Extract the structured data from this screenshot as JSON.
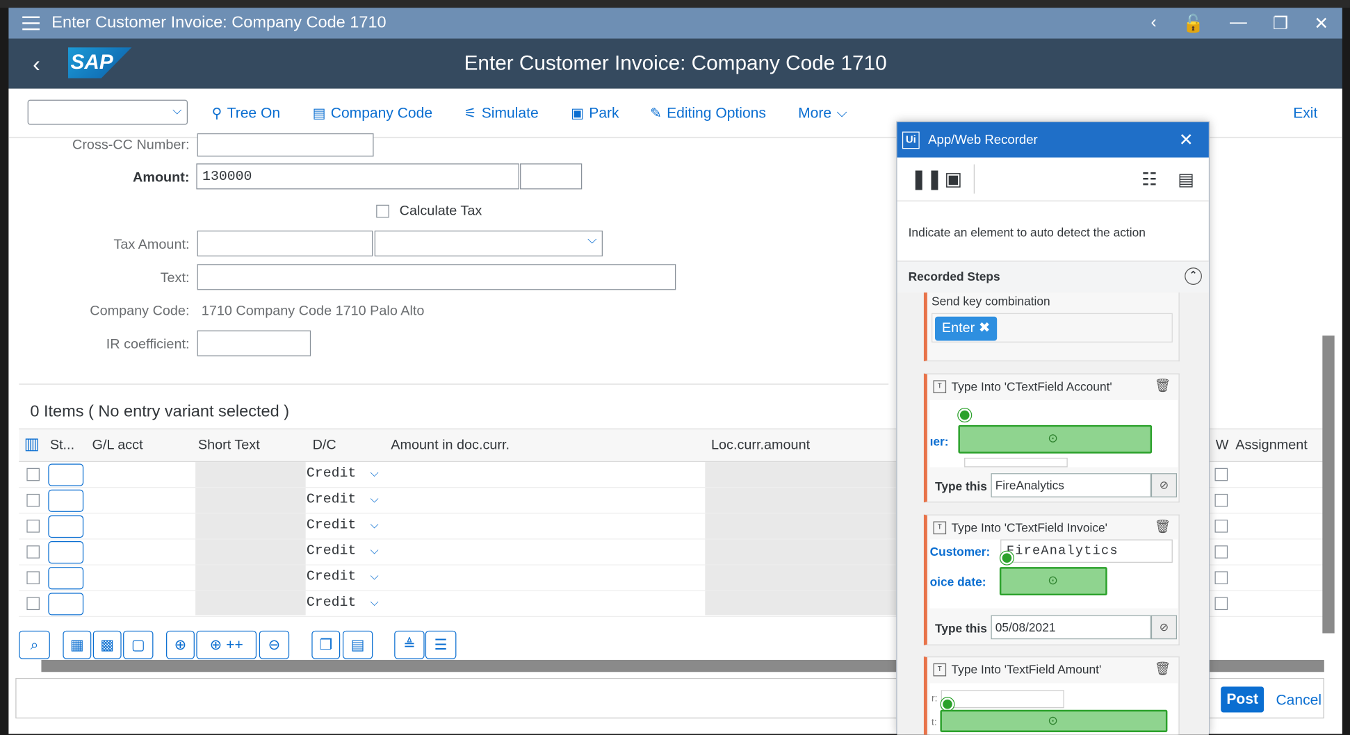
{
  "window": {
    "title": "Enter Customer Invoice: Company Code 1710"
  },
  "shell": {
    "title": "Enter Customer Invoice: Company Code 1710",
    "logo": "SAP"
  },
  "toolbar": {
    "items": [
      {
        "label": "Tree On",
        "icon": "tree-icon"
      },
      {
        "label": "Company Code",
        "icon": "company-code-icon"
      },
      {
        "label": "Simulate",
        "icon": "simulate-icon"
      },
      {
        "label": "Park",
        "icon": "save-icon"
      },
      {
        "label": "Editing Options",
        "icon": "pencil-icon"
      },
      {
        "label": "More",
        "icon": "chevron-down-icon"
      }
    ],
    "exit": "Exit"
  },
  "form": {
    "cross_cc_label": "Cross-CC Number:",
    "amount_label": "Amount:",
    "amount_value": "130000",
    "calc_tax_label": "Calculate Tax",
    "tax_amount_label": "Tax Amount:",
    "text_label": "Text:",
    "company_code_label": "Company Code:",
    "company_code_value": "1710 Company Code 1710 Palo Alto",
    "ir_label": "IR coefficient:"
  },
  "items": {
    "title": "0 Items ( No entry variant selected )",
    "columns": [
      "St...",
      "G/L acct",
      "Short Text",
      "D/C",
      "Amount in doc.curr.",
      "Loc.curr.amount",
      "W",
      "Assignment"
    ],
    "dc_value": "Credit",
    "row_count": 6
  },
  "footer": {
    "post": "Post",
    "cancel": "Cancel"
  },
  "recorder": {
    "title": "App/Web Recorder",
    "instruction": "Indicate an element to auto detect the action",
    "steps_title": "Recorded Steps",
    "step1": {
      "title": "Send key combination",
      "key": "Enter"
    },
    "step2": {
      "title": "Type Into 'CTextField Account'",
      "field_label": "ıer:",
      "type_label": "Type this",
      "value": "FireAnalytics"
    },
    "step3": {
      "title": "Type Into 'CTextField Invoice'",
      "customer_label": "Customer:",
      "customer_value": "FireAnalytics",
      "date_label": "oice date:",
      "type_label": "Type this",
      "value": "05/08/2021"
    },
    "step4": {
      "title": "Type Into 'TextField Amount'",
      "r_label": "r:",
      "t_label": "t:"
    }
  }
}
